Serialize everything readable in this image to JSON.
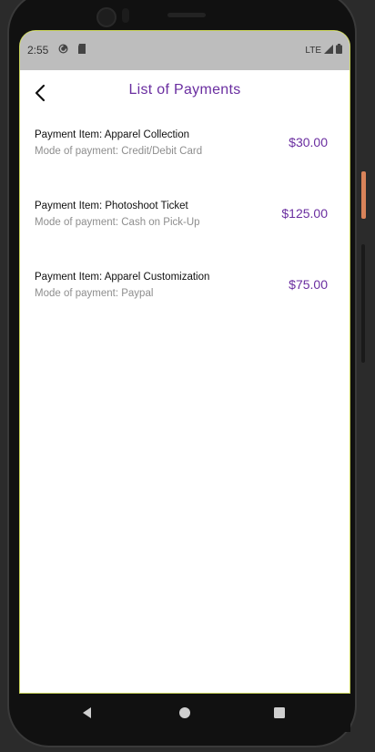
{
  "status_bar": {
    "time": "2:55",
    "network": "LTE",
    "icons": [
      "pocket-casts-icon",
      "sd-card-icon",
      "signal-icon",
      "battery-icon"
    ]
  },
  "header": {
    "title": "List of Payments",
    "back_icon": "back-arrow-icon"
  },
  "payments": [
    {
      "item": "Payment Item: Apparel Collection",
      "mode": "Mode of payment: Credit/Debit Card",
      "amount": "$30.00"
    },
    {
      "item": "Payment Item: Photoshoot Ticket",
      "mode": "Mode of payment: Cash on Pick-Up",
      "amount": "$125.00"
    },
    {
      "item": "Payment Item: Apparel Customization",
      "mode": "Mode of payment: Paypal",
      "amount": "$75.00"
    }
  ],
  "nav_bar": {
    "icons": [
      "back-triangle-icon",
      "home-circle-icon",
      "recents-square-icon"
    ]
  },
  "colors": {
    "accent": "#6a2ea0",
    "status_bar_bg": "#bdbdbd",
    "secondary_text": "#8e8e8e"
  }
}
